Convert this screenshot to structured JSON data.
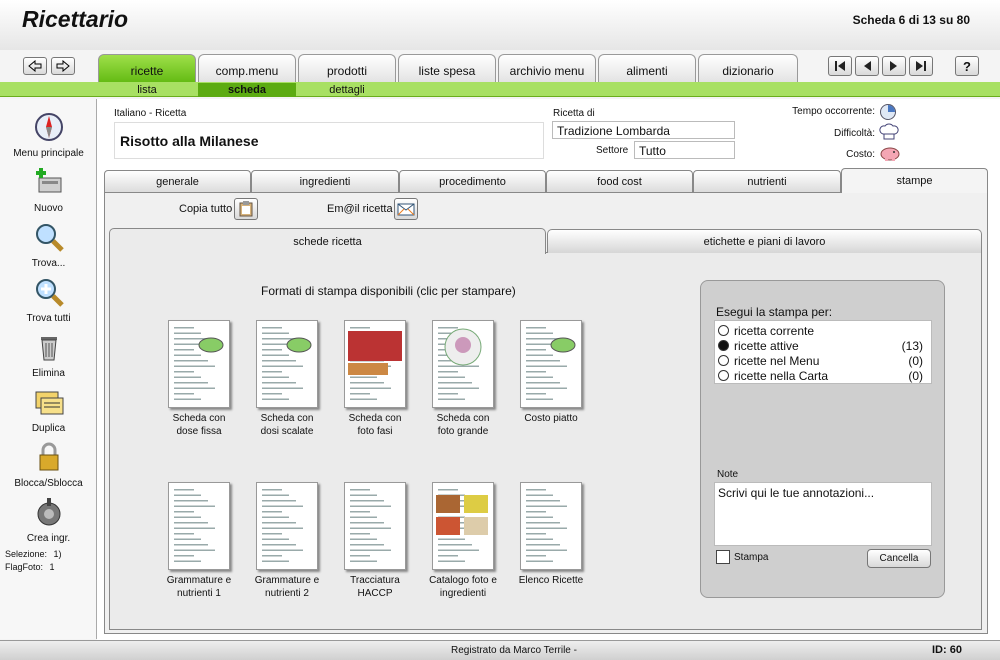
{
  "header": {
    "title": "Ricettario",
    "record_counter": "Scheda 6 di 13 su 80",
    "help_label": "?"
  },
  "main_tabs": [
    "ricette",
    "comp.menu",
    "prodotti",
    "liste spesa",
    "archivio menu",
    "alimenti",
    "dizionario"
  ],
  "sub_tabs": [
    "lista",
    "scheda",
    "dettagli"
  ],
  "left_nav": {
    "items": [
      "Menu principale",
      "Nuovo",
      "Trova...",
      "Trova tutti",
      "Elimina",
      "Duplica",
      "Blocca/Sblocca",
      "Crea ingr."
    ],
    "selezione_label": "Selezione:",
    "selezione_value": "1)",
    "flagfoto_label": "FlagFoto:",
    "flagfoto_value": "1"
  },
  "recipe": {
    "category_label": "Italiano - Ricetta",
    "name": "Risotto alla Milanese",
    "ricetta_di_label": "Ricetta di",
    "ricetta_di_value": "Tradizione Lombarda",
    "settore_label": "Settore",
    "settore_value": "Tutto",
    "tempo_label": "Tempo occorrente:",
    "difficolta_label": "Difficoltà:",
    "costo_label": "Costo:"
  },
  "detail_tabs": [
    "generale",
    "ingredienti",
    "procedimento",
    "food cost",
    "nutrienti",
    "stampe"
  ],
  "actions": {
    "copia_label": "Copia tutto",
    "email_label": "Em@il ricetta"
  },
  "print_tabs": [
    "schede ricetta",
    "etichette e piani di lavoro"
  ],
  "print_formats": {
    "heading": "Formati di stampa disponibili (clic per stampare)",
    "items": [
      "Scheda con\ndose fissa",
      "Scheda con\ndosi scalate",
      "Scheda con\nfoto fasi",
      "Scheda con\nfoto grande",
      "Costo piatto",
      "Grammature e\nnutrienti 1",
      "Grammature e\nnutrienti 2",
      "Tracciatura\nHACCP",
      "Catalogo foto e\ningredienti",
      "Elenco Ricette"
    ]
  },
  "print_options": {
    "heading": "Esegui la stampa per:",
    "options": [
      {
        "label": "ricetta corrente",
        "count": ""
      },
      {
        "label": "ricette attive",
        "count": "(13)"
      },
      {
        "label": "ricette nel Menu",
        "count": "(0)"
      },
      {
        "label": "ricette nella Carta",
        "count": "(0)"
      }
    ],
    "selected_index": 1,
    "note_label": "Note",
    "note_value": "Scrivi qui le tue annotazioni...",
    "stampa_label": "Stampa",
    "cancella_label": "Cancella"
  },
  "footer": {
    "registered": "Registrato da Marco Terrile -",
    "id_label": "ID: 60"
  }
}
